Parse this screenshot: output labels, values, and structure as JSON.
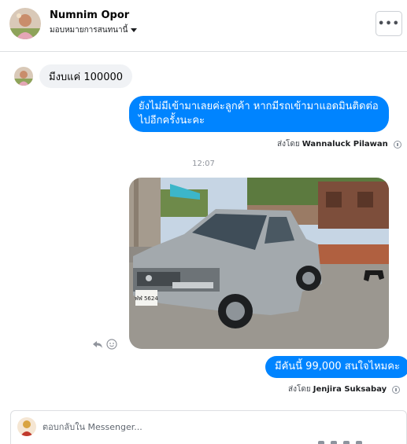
{
  "header": {
    "name": "Numnim Opor",
    "subtitle": "มอบหมายการสนทนานี้",
    "more_label": "•••"
  },
  "messages": {
    "incoming_text": "มีงบแค่ 100000",
    "outgoing_1_text": "ยังไม่มีเข้ามาเลยค่ะลูกค้า  หากมีรถเข้ามาแอดมินติดต่อไปอีกครั้งนะคะ",
    "sent_by_1_prefix": "ส่งโดย",
    "sent_by_1_name": "Wannaluck Pilawan",
    "timestamp": "12:07",
    "outgoing_2_text": "มีคันนี้ 99,000 สนใจไหมคะ",
    "sent_by_2_prefix": "ส่งโดย",
    "sent_by_2_name": "Jenjira Suksabay",
    "photo_plate": "ฬฬ 5624"
  },
  "composer": {
    "placeholder": "ตอบกลับใน Messenger..."
  },
  "colors": {
    "accent": "#0084ff",
    "incoming_bubble": "#f0f2f5",
    "border": "#dddfe2"
  },
  "icons": [
    "chevron-down-icon",
    "more-icon",
    "info-icon",
    "reply-icon",
    "emoji-icon"
  ]
}
